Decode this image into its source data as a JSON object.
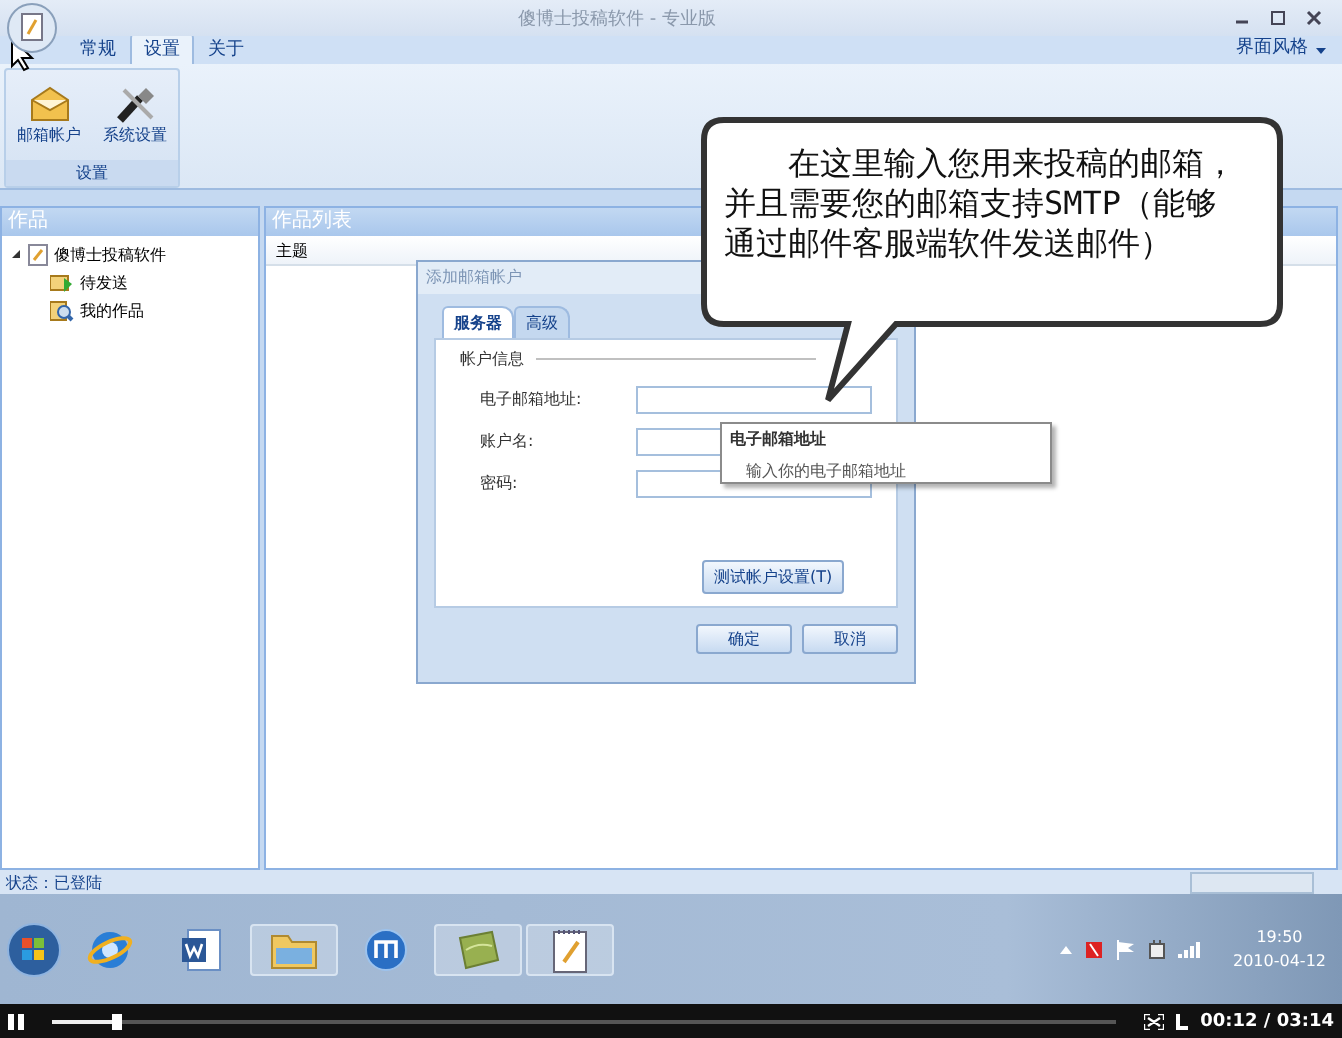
{
  "window": {
    "title": "傻博士投稿软件 - 专业版"
  },
  "ribbon": {
    "tabs": [
      {
        "label": "常规",
        "selected": false
      },
      {
        "label": "设置",
        "selected": true
      },
      {
        "label": "关于",
        "selected": false
      }
    ],
    "style_menu": "界面风格",
    "groups": [
      {
        "label": "设置",
        "buttons": [
          {
            "label": "邮箱帐户",
            "kind": "mail"
          },
          {
            "label": "系统设置",
            "kind": "tools"
          }
        ]
      }
    ]
  },
  "left_pane": {
    "title": "作品",
    "tree": [
      {
        "label": "傻博士投稿软件",
        "kind": "doc",
        "expanded": true,
        "children": [
          {
            "label": "待发送",
            "kind": "outbox"
          },
          {
            "label": "我的作品",
            "kind": "search"
          }
        ]
      }
    ]
  },
  "right_pane": {
    "title": "作品列表",
    "columns": [
      "主题"
    ]
  },
  "dialog": {
    "title": "添加邮箱帐户",
    "tabs": [
      {
        "label": "服务器",
        "selected": true
      },
      {
        "label": "高级",
        "selected": false
      }
    ],
    "group": "帐户信息",
    "fields": [
      {
        "label": "电子邮箱地址:"
      },
      {
        "label": "账户名:"
      },
      {
        "label": "密码:"
      }
    ],
    "test_button": "测试帐户设置(T)",
    "buttons": [
      "确定",
      "取消"
    ]
  },
  "tooltip": {
    "title": "电子邮箱地址",
    "text": "输入你的电子邮箱地址"
  },
  "callout": {
    "text": "在这里输入您用来投稿的邮箱，并且需要您的邮箱支持SMTP（能够通过邮件客服端软件发送邮件）"
  },
  "status_bar": {
    "text": "状态：已登陆"
  },
  "taskbar": {
    "apps": [
      {
        "kind": "ie",
        "open": false
      },
      {
        "kind": "word",
        "open": false
      },
      {
        "kind": "folder",
        "open": true
      },
      {
        "kind": "maxthon",
        "open": false
      },
      {
        "kind": "green",
        "open": true
      },
      {
        "kind": "notepad",
        "open": true
      }
    ],
    "time": "19:50",
    "date": "2010-04-12"
  },
  "player": {
    "playing": true,
    "level": 0.06,
    "time": "00:12 / 03:14"
  }
}
